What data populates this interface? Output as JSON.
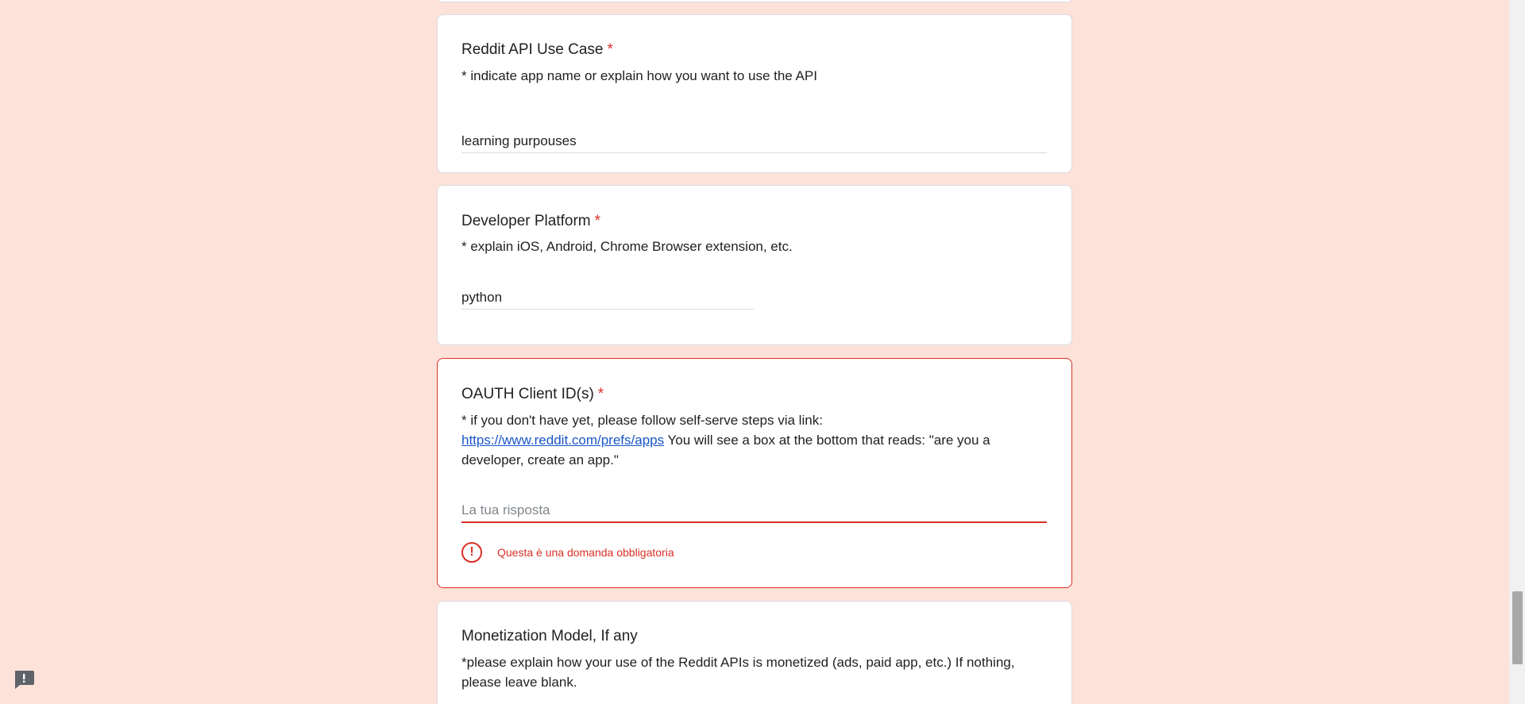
{
  "questions": [
    {
      "title": "Reddit API Use Case",
      "required_mark": "*",
      "description": "* indicate app name or explain how you want to use the API",
      "answer": "learning purpouses"
    },
    {
      "title": "Developer Platform",
      "required_mark": "*",
      "description": "* explain iOS, Android, Chrome Browser extension, etc.",
      "answer": "python"
    },
    {
      "title": "OAUTH Client ID(s)",
      "required_mark": "*",
      "description_line1": "* if you don't have yet, please follow self-serve steps via link:",
      "link_text": "https://www.reddit.com/prefs/apps",
      "description_rest": " You will see a box at the bottom that reads: \"are you a developer, create an app.\"",
      "answer": "",
      "placeholder": "La tua risposta",
      "error_message": "Questa è una domanda obbligatoria",
      "error_icon": "error-exclamation-icon"
    },
    {
      "title": "Monetization Model, If any",
      "description": "*please explain how your use of the Reddit APIs is monetized (ads, paid app, etc.)  If nothing, please leave blank."
    }
  ],
  "feedback_icon": "report-feedback-icon",
  "colors": {
    "background": "#fde2d9",
    "error": "#d93025",
    "link": "#1a56c7"
  }
}
